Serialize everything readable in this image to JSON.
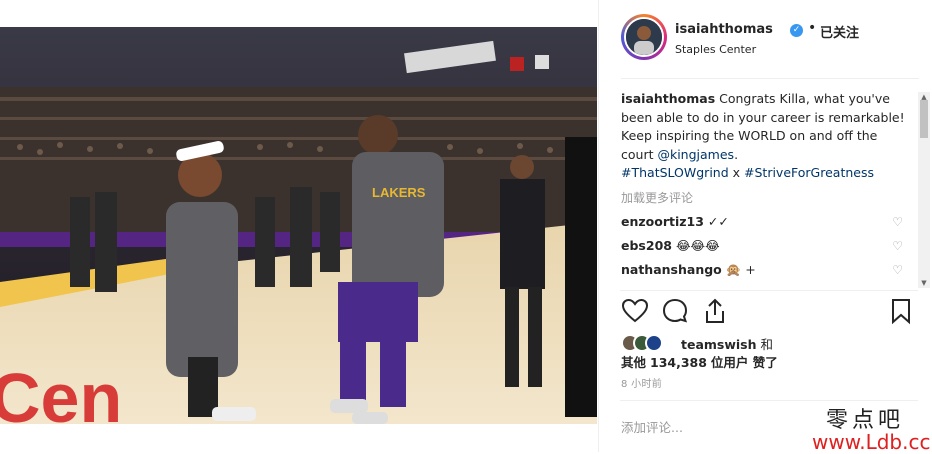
{
  "post": {
    "username": "isaiahthomas",
    "follow_status": "已关注",
    "location": "Staples Center",
    "caption_user": "isaiahthomas",
    "caption_text": "Congrats Killa, what you've been able to do in your career is remarkable! Keep inspiring the WORLD on and off the court",
    "mention": "@kingjames",
    "hashtag_line": ".",
    "hashtag1": "#ThatSLOWgrind",
    "hashtag_sep": " x ",
    "hashtag2": "#StriveForGreatness",
    "load_more": "加载更多评论",
    "comments": [
      {
        "user": "enzoortiz13",
        "text": "✓✓"
      },
      {
        "user": "ebs208",
        "text": "😂😂😂"
      },
      {
        "user": "nathanshango",
        "text": "🙊 +"
      }
    ],
    "likes_user": "teamswish",
    "likes_and": "和",
    "likes_other_prefix": "其他",
    "likes_count": "134,388",
    "likes_suffix": "位用户 赞了",
    "time_ago": "8 小时前",
    "add_comment_placeholder": "添加评论..."
  },
  "photo": {
    "jersey_text": "LAKERS",
    "arena_text": "Cen"
  },
  "watermark": {
    "line1": "零点吧",
    "line2": "www.Ldb.cc"
  },
  "colors": {
    "accent_blue": "#3897f0",
    "link_blue": "#003569",
    "lakers_purple": "#552583",
    "lakers_gold": "#fdb927",
    "watermark_red": "#e02020"
  }
}
